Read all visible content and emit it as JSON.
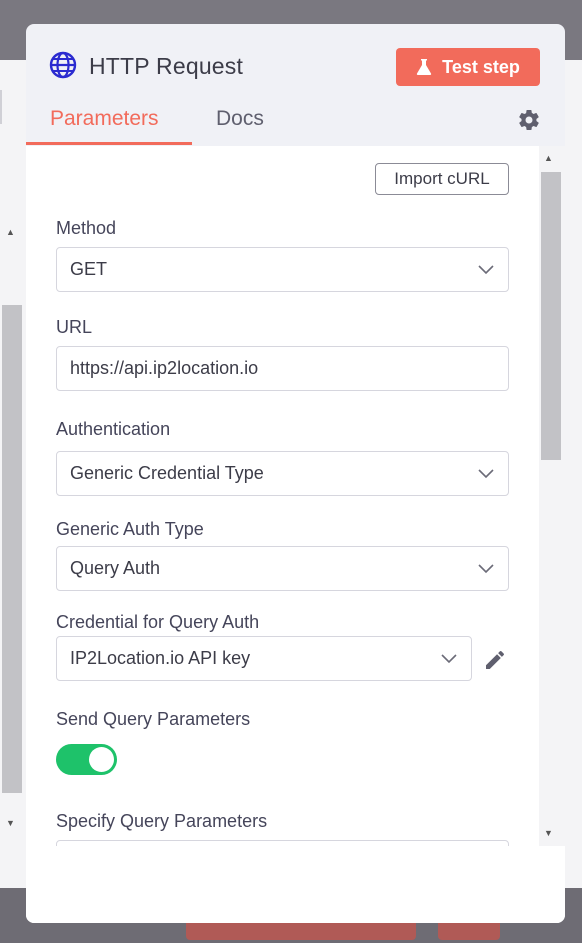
{
  "node": {
    "title": "HTTP Request",
    "test_step_label": "Test step"
  },
  "tabs": [
    {
      "label": "Parameters",
      "active": true
    },
    {
      "label": "Docs",
      "active": false
    }
  ],
  "import_curl_label": "Import cURL",
  "fields": {
    "method": {
      "label": "Method",
      "value": "GET"
    },
    "url": {
      "label": "URL",
      "value": "https://api.ip2location.io"
    },
    "authentication": {
      "label": "Authentication",
      "value": "Generic Credential Type"
    },
    "generic_auth_type": {
      "label": "Generic Auth Type",
      "value": "Query Auth"
    },
    "credential": {
      "label": "Credential for Query Auth",
      "value": "IP2Location.io API key"
    },
    "send_query_params": {
      "label": "Send Query Parameters",
      "enabled": true
    },
    "specify_query_params": {
      "label": "Specify Query Parameters"
    }
  },
  "colors": {
    "accent": "#f26b5b",
    "toggle_on": "#1ec26a",
    "globe": "#2b2bd0"
  }
}
